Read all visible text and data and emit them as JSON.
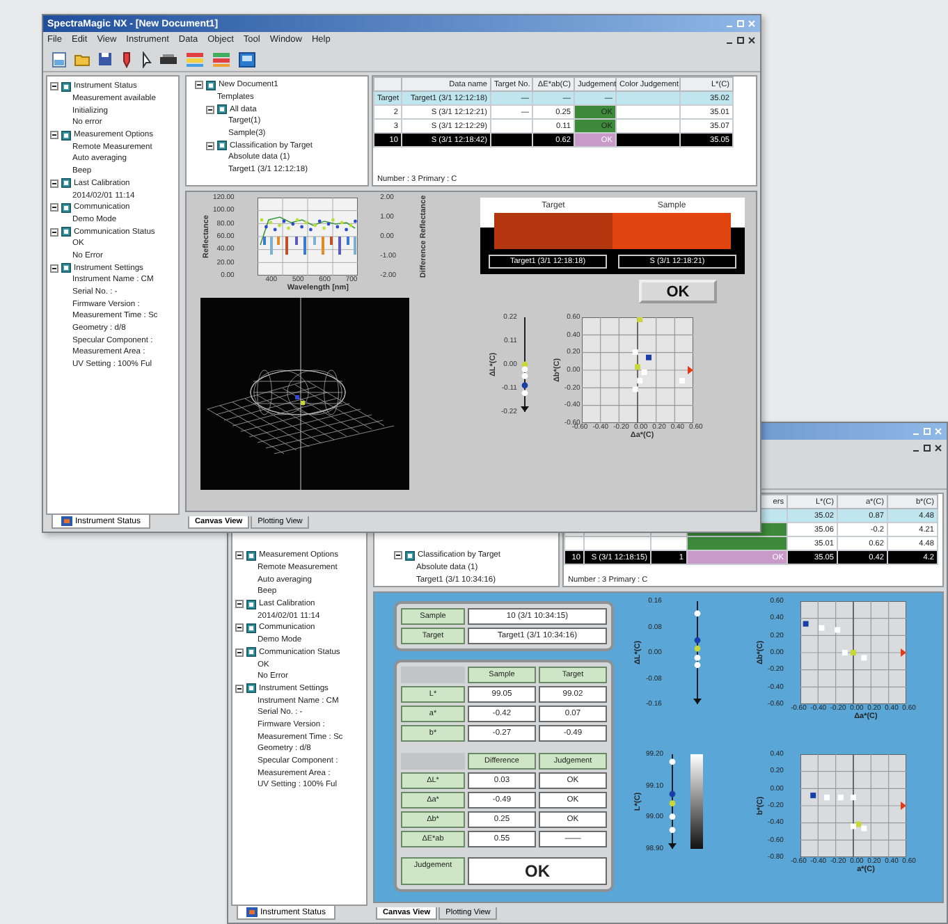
{
  "window1": {
    "title": "SpectraMagic NX - [New Document1]",
    "menu": [
      "File",
      "Edit",
      "View",
      "Instrument",
      "Data",
      "Object",
      "Tool",
      "Window",
      "Help"
    ],
    "status_tree": [
      {
        "label": "Instrument Status",
        "expanded": true,
        "children": [
          {
            "label": "Measurement available"
          },
          {
            "label": "Initializing"
          },
          {
            "label": "No error"
          }
        ]
      },
      {
        "label": "Measurement Options",
        "expanded": true,
        "children": [
          {
            "label": "Remote Measurement"
          },
          {
            "label": "Auto averaging"
          },
          {
            "label": "Beep"
          }
        ]
      },
      {
        "label": "Last Calibration",
        "expanded": true,
        "children": [
          {
            "label": "2014/02/01 11:14"
          }
        ]
      },
      {
        "label": "Communication",
        "expanded": true,
        "children": [
          {
            "label": "Demo Mode"
          }
        ]
      },
      {
        "label": "Communication Status",
        "expanded": true,
        "children": [
          {
            "label": "OK"
          },
          {
            "label": "No Error"
          }
        ]
      },
      {
        "label": "Instrument Settings",
        "expanded": true,
        "children": [
          {
            "label": "Instrument Name : CM"
          },
          {
            "label": "Serial No. : -"
          },
          {
            "label": "Firmware Version :"
          },
          {
            "label": "Measurement Time : Sc"
          },
          {
            "label": "Geometry : d/8"
          },
          {
            "label": "Specular Component :"
          },
          {
            "label": "Measurement Area :"
          },
          {
            "label": "UV Setting : 100% Ful"
          }
        ]
      }
    ],
    "status_tab": "Instrument Status",
    "doc_tree": [
      {
        "label": "New Document1",
        "expanded": true,
        "children": [
          {
            "label": "Templates"
          },
          {
            "label": "All data",
            "expanded": true,
            "children": [
              {
                "label": "Target(1)"
              },
              {
                "label": "Sample(3)"
              }
            ]
          },
          {
            "label": "Classification by Target",
            "expanded": true,
            "children": [
              {
                "label": "Absolute data (1)"
              },
              {
                "label": "Target1 (3/1 12:12:18)"
              }
            ]
          }
        ]
      }
    ],
    "table": {
      "columns": [
        null,
        "Data name",
        "Target No.",
        "ΔE*ab(C)",
        "Judgement",
        "Color Judgement",
        "L*(C)"
      ],
      "rows": [
        {
          "kind": "target",
          "selected": false,
          "cells": [
            "Target",
            "Target1 (3/1 12:12:18)",
            "—",
            "—",
            "—",
            null,
            "35.02"
          ]
        },
        {
          "kind": "sample",
          "selected": false,
          "color": "#3d8a3a",
          "cells": [
            "2",
            "S (3/1 12:12:21)",
            "—",
            "0.25",
            "OK",
            null,
            "35.01"
          ]
        },
        {
          "kind": "sample",
          "selected": false,
          "color": "#3d8a3a",
          "cells": [
            "3",
            "S (3/1 12:12:29)",
            null,
            "0.11",
            "OK",
            null,
            "35.07"
          ]
        },
        {
          "kind": "sample",
          "selected": true,
          "color": "#c99ac9",
          "cells": [
            "10",
            "S (3/1 12:18:42)",
            null,
            "0.62",
            "OK",
            null,
            "35.05"
          ]
        }
      ]
    },
    "table_status": "Number : 3  Primary : C",
    "canvas": {
      "spectral_chart": {
        "ylabel": "Reflectance",
        "yticks": [
          "120.00",
          "100.00",
          "80.00",
          "60.00",
          "40.00",
          "20.00",
          "0.00"
        ],
        "y2label": "Difference Reflectance",
        "y2ticks": [
          "2.00",
          "1.00",
          "0.00",
          "-1.00",
          "-2.00"
        ],
        "xticks": [
          "400",
          "500",
          "600",
          "700"
        ],
        "xlabel": "Wavelength [nm]"
      },
      "patches": [
        {
          "label": "Target",
          "color": "#b4360f",
          "caption": "Target1 (3/1 12:18:18)"
        },
        {
          "label": "Sample",
          "color": "#e2440f",
          "caption": "S (3/1 12:18:21)"
        }
      ],
      "ok_button": "OK",
      "bar_chart": {
        "ylabel": "ΔL*(C)",
        "yticks": [
          "0.22",
          "0.11",
          "0.00",
          "-0.11",
          "-0.22"
        ]
      },
      "scatter": {
        "ylabel": "Δb*(C)",
        "yticks": [
          "0.60",
          "0.40",
          "0.20",
          "0.00",
          "-0.20",
          "-0.40",
          "-0.60"
        ],
        "xticks": [
          "-0.60",
          "-0.40",
          "-0.20",
          "0.00",
          "0.20",
          "0.40",
          "0.60"
        ],
        "xlabel": "Δa*(C)"
      }
    },
    "view_tabs": [
      {
        "label": "Canvas View",
        "selected": true
      },
      {
        "label": "Plotting View",
        "selected": false
      }
    ]
  },
  "window2": {
    "status_tree": [
      {
        "label": "Measurement Options",
        "expanded": true,
        "children": [
          {
            "label": "Remote Measurement"
          },
          {
            "label": "Auto averaging"
          },
          {
            "label": "Beep"
          }
        ]
      },
      {
        "label": "Last Calibration",
        "expanded": true,
        "children": [
          {
            "label": "2014/02/01 11:14"
          }
        ]
      },
      {
        "label": "Communication",
        "expanded": true,
        "children": [
          {
            "label": "Demo Mode"
          }
        ]
      },
      {
        "label": "Communication Status",
        "expanded": true,
        "children": [
          {
            "label": "OK"
          },
          {
            "label": "No Error"
          }
        ]
      },
      {
        "label": "Instrument Settings",
        "expanded": true,
        "children": [
          {
            "label": "Instrument Name : CM"
          },
          {
            "label": "Serial No. : -"
          },
          {
            "label": "Firmware Version :"
          },
          {
            "label": "Measurement Time : Sc"
          },
          {
            "label": "Geometry : d/8"
          },
          {
            "label": "Specular Component :"
          },
          {
            "label": "Measurement Area :"
          },
          {
            "label": "UV Setting : 100% Ful"
          }
        ]
      }
    ],
    "status_tab": "Instrument Status",
    "doc_tree": [
      {
        "label": "Classification by Target",
        "expanded": true,
        "children": [
          {
            "label": "Absolute data (1)"
          },
          {
            "label": "Target1 (3/1 10:34:16)"
          }
        ]
      }
    ],
    "table": {
      "columns": [
        null,
        null,
        null,
        "ers",
        "L*(C)",
        "a*(C)",
        "b*(C)"
      ],
      "rows": [
        {
          "kind": "target",
          "selected": false,
          "cells": [
            null,
            null,
            null,
            null,
            "35.02",
            "0.87",
            "4.48"
          ]
        },
        {
          "kind": "sample",
          "selected": false,
          "color": "#3d8a3a",
          "cells": [
            null,
            null,
            null,
            null,
            "35.06",
            "-0.2",
            "4.21"
          ]
        },
        {
          "kind": "sample",
          "selected": false,
          "color": "#3d8a3a",
          "cells": [
            null,
            null,
            null,
            null,
            "35.01",
            "0.62",
            "4.48"
          ]
        },
        {
          "kind": "sample",
          "selected": true,
          "color": "#c99ac9",
          "cells": [
            "10",
            "S (3/1 12:18:15)",
            "1",
            "OK",
            "35.05",
            "0.42",
            "4.2"
          ]
        }
      ]
    },
    "table_status": "Number : 3  Primary : C",
    "canvas": {
      "info": [
        {
          "label": "Sample",
          "value": "10 (3/1 10:34:15)"
        },
        {
          "label": "Target",
          "value": "Target1 (3/1 10:34:16)"
        }
      ],
      "values_table": {
        "columns": [
          "Sample",
          "Target"
        ],
        "rows": [
          {
            "label": "L*",
            "values": [
              "99.05",
              "99.02"
            ]
          },
          {
            "label": "a*",
            "values": [
              "-0.42",
              "0.07"
            ]
          },
          {
            "label": "b*",
            "values": [
              "-0.27",
              "-0.49"
            ]
          }
        ]
      },
      "diff_table": {
        "columns": [
          "Difference",
          "Judgement"
        ],
        "rows": [
          {
            "label": "ΔL*",
            "values": [
              "0.03",
              "OK"
            ]
          },
          {
            "label": "Δa*",
            "values": [
              "-0.49",
              "OK"
            ]
          },
          {
            "label": "Δb*",
            "values": [
              "0.25",
              "OK"
            ]
          },
          {
            "label": "ΔE*ab",
            "values": [
              "0.55",
              "——"
            ]
          }
        ]
      },
      "judgement": {
        "label": "Judgement",
        "value": "OK"
      },
      "bar1": {
        "ylabel": "ΔL*(C)",
        "yticks": [
          "0.16",
          "0.08",
          "0.00",
          "-0.08",
          "-0.16"
        ]
      },
      "scatter1": {
        "ylabel": "Δb*(C)",
        "yticks": [
          "0.60",
          "0.40",
          "0.20",
          "0.00",
          "-0.20",
          "-0.40",
          "-0.60"
        ],
        "xticks": [
          "-0.60",
          "-0.40",
          "-0.20",
          "0.00",
          "0.20",
          "0.40",
          "0.60"
        ],
        "xlabel": "Δa*(C)"
      },
      "bar2": {
        "ylabel": "L*(C)",
        "yticks": [
          "99.20",
          "99.10",
          "99.00",
          "98.90"
        ]
      },
      "scatter2": {
        "ylabel": "b*(C)",
        "yticks": [
          "0.40",
          "0.20",
          "0.00",
          "-0.20",
          "-0.40",
          "-0.60",
          "-0.80"
        ],
        "xticks": [
          "-0.60",
          "-0.40",
          "-0.20",
          "0.00",
          "0.20",
          "0.40",
          "0.60"
        ],
        "xlabel": "a*(C)"
      }
    },
    "view_tabs": [
      {
        "label": "Canvas View",
        "selected": true
      },
      {
        "label": "Plotting View",
        "selected": false
      }
    ]
  }
}
